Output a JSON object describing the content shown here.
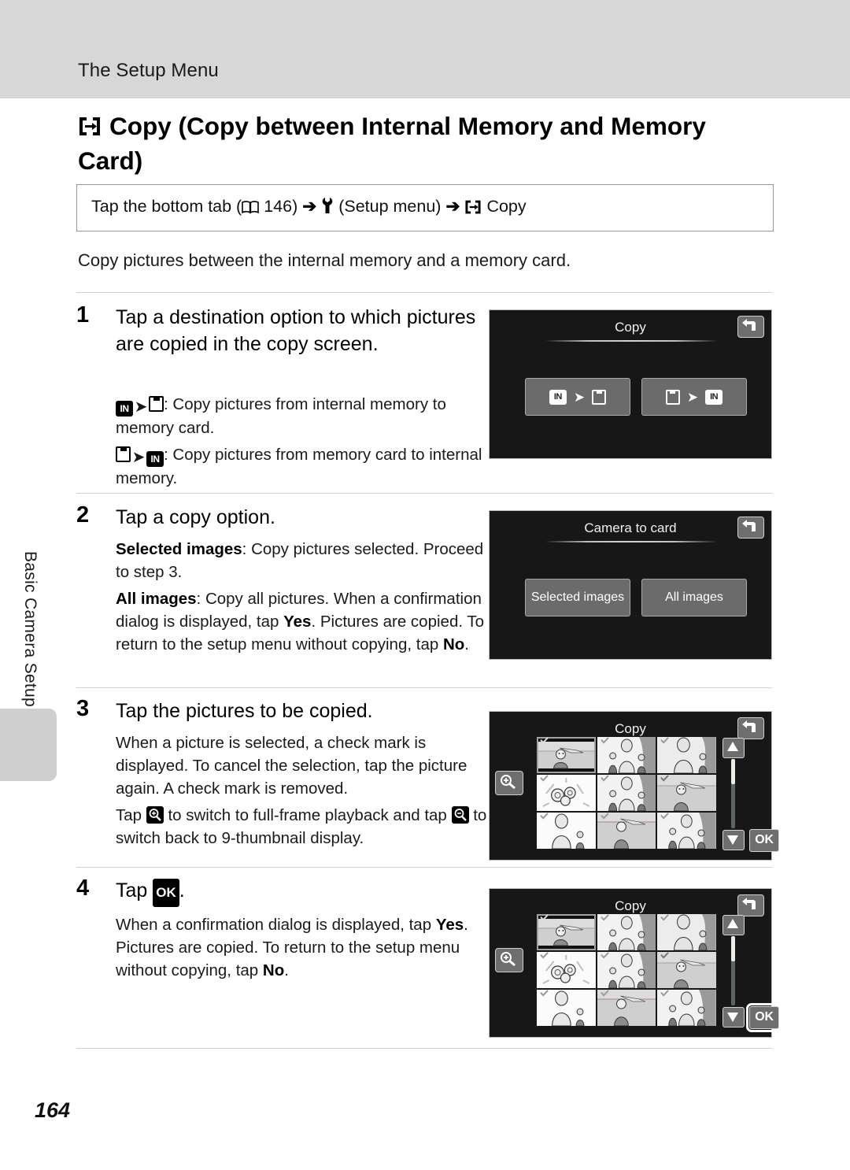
{
  "header": {
    "running_head": "The Setup Menu",
    "page_title": "Copy (Copy between Internal Memory and Memory Card)",
    "title_icon": "copy-icon"
  },
  "breadcrumb": {
    "prefix": "Tap the bottom tab (",
    "book_icon": "book-icon",
    "page_ref": "146",
    "after_ref": ") ",
    "arrow": "➔",
    "wrench_icon": "wrench-icon",
    "setup_label": " (Setup menu) ",
    "arrow2": "➔",
    "copy_icon": "copy-icon",
    "copy_label": "Copy"
  },
  "intro": "Copy pictures between the internal memory and a memory card.",
  "steps": [
    {
      "number": "1",
      "heading": "Tap a destination option to which pictures are copied in the copy screen.",
      "body_1_prefix": ": Copy pictures from internal memory to memory card.",
      "body_2_prefix": ": Copy pictures from memory card to internal memory."
    },
    {
      "number": "2",
      "heading": "Tap a copy option.",
      "b1_bold": "Selected images",
      "b1_text": ": Copy pictures selected. Proceed to step 3.",
      "b2_bold": "All images",
      "b2_text_a": ": Copy all pictures. When a confirmation dialog is displayed, tap ",
      "b2_yes": "Yes",
      "b2_text_b": ". Pictures are copied. To return to the setup menu without copying, tap ",
      "b2_no": "No",
      "b2_text_c": "."
    },
    {
      "number": "3",
      "heading": "Tap the pictures to be copied.",
      "b1_text": "When a picture is selected, a check mark is displayed. To cancel the selection, tap the picture again. A check mark is removed.",
      "b2_a": "Tap ",
      "b2_b": " to switch to full-frame playback and tap ",
      "b2_c": " to switch back to 9-thumbnail display."
    },
    {
      "number": "4",
      "heading_a": "Tap ",
      "heading_ok": "OK",
      "heading_b": ".",
      "b1_a": "When a confirmation dialog is displayed, tap ",
      "b1_yes": "Yes",
      "b1_b": ". Pictures are copied. To return to the setup menu without copying, tap ",
      "b1_no": "No",
      "b1_c": "."
    }
  ],
  "screens": [
    {
      "id": "copy-destination-screen",
      "title": "Copy",
      "back_icon": "back-arrow-icon",
      "buttons": [
        {
          "id": "internal-to-card-button",
          "icons": [
            "IN",
            "➔",
            "card"
          ]
        },
        {
          "id": "card-to-internal-button",
          "icons": [
            "card",
            "➔",
            "IN"
          ]
        }
      ]
    },
    {
      "id": "camera-to-card-screen",
      "title": "Camera to card",
      "back_icon": "back-arrow-icon",
      "buttons": [
        {
          "id": "selected-images-button",
          "label": "Selected images"
        },
        {
          "id": "all-images-button",
          "label": "All images"
        }
      ]
    },
    {
      "id": "thumbnail-select-screen",
      "title": "Copy",
      "back_icon": "back-arrow-icon",
      "magnifier_icon": "magnifier-plus-icon",
      "scroll_up_icon": "triangle-up-icon",
      "scroll_down_icon": "triangle-down-icon",
      "ok_label": "OK",
      "ok_highlighted": false
    },
    {
      "id": "thumbnail-confirm-screen",
      "title": "Copy",
      "back_icon": "back-arrow-icon",
      "magnifier_icon": "magnifier-plus-icon",
      "scroll_up_icon": "triangle-up-icon",
      "scroll_down_icon": "triangle-down-icon",
      "ok_label": "OK",
      "ok_highlighted": true
    }
  ],
  "side_tab": {
    "label": "Basic Camera Setup"
  },
  "page_number": "164",
  "colors": {
    "header_band": "#d7d7d7",
    "screen_bg": "#171717",
    "screen_button": "#6b6b6b",
    "side_tab": "#cfcfcf",
    "rule": "#d0d0d0"
  }
}
